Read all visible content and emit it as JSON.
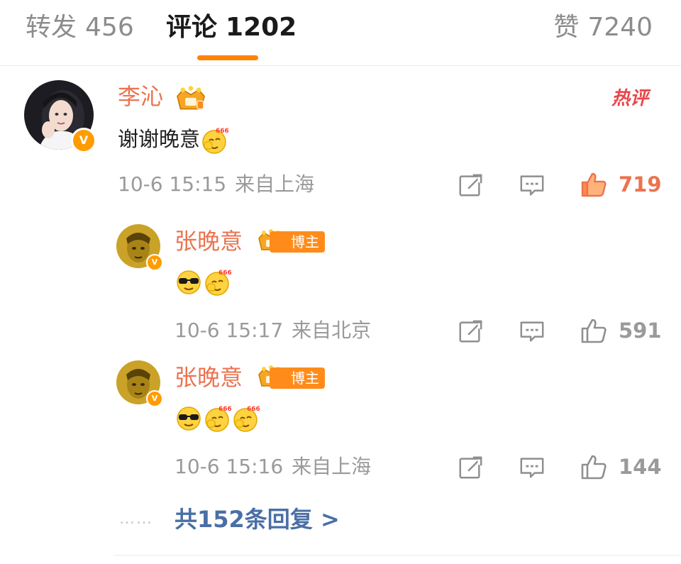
{
  "tabs": {
    "repost_label": "转发",
    "repost_count": "456",
    "comments_label": "评论",
    "comments_count": "1202",
    "likes_label": "赞",
    "likes_count": "7240"
  },
  "colors": {
    "accent": "#ff8200",
    "name": "#eb7350",
    "link": "#4a6fa5",
    "meta": "#9a9a9a",
    "hot": "#e8474b"
  },
  "comment": {
    "author": "李沁",
    "hot_tag": "热评",
    "text": "谢谢晚意",
    "emojis": [
      "666-emoji"
    ],
    "date": "10-6 15:15",
    "location": "来自上海",
    "likes": "719",
    "liked": true
  },
  "replies": [
    {
      "author": "张晚意",
      "role_tag": "博主",
      "emojis": [
        "sunglasses-emoji",
        "666-emoji"
      ],
      "date": "10-6 15:17",
      "location": "来自北京",
      "likes": "591"
    },
    {
      "author": "张晚意",
      "role_tag": "博主",
      "emojis": [
        "sunglasses-emoji",
        "666-emoji",
        "666-emoji"
      ],
      "date": "10-6 15:16",
      "location": "来自上海",
      "likes": "144"
    }
  ],
  "more_replies": {
    "dots": "……",
    "label": "共152条回复 >"
  },
  "icons": [
    "repost-icon",
    "reply-icon",
    "like-icon",
    "verified-icon",
    "crown-badge-icon"
  ]
}
